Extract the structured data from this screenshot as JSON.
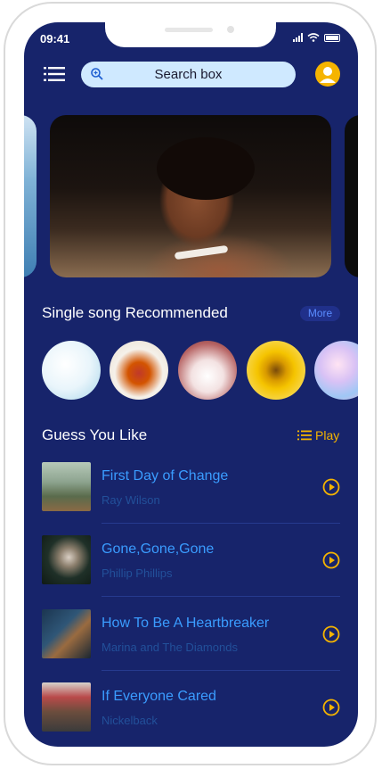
{
  "status_bar": {
    "time": "09:41"
  },
  "search": {
    "placeholder": "Search box"
  },
  "section_recommended": {
    "title": "Single song Recommended",
    "more_label": "More"
  },
  "section_guess": {
    "title": "Guess You Like",
    "play_label": "Play"
  },
  "songs": [
    {
      "title": "First Day of Change",
      "artist": "Ray Wilson"
    },
    {
      "title": "Gone,Gone,Gone",
      "artist": "Phillip Phillips"
    },
    {
      "title": "How To Be A Heartbreaker",
      "artist": "Marina and The Diamonds"
    },
    {
      "title": "If Everyone Cared",
      "artist": "Nickelback"
    }
  ],
  "colors": {
    "screen_bg": "#17246b",
    "accent_yellow": "#f5b400",
    "song_title": "#3a9cff",
    "artist": "#22509a",
    "search_bg": "#cfe9ff"
  }
}
